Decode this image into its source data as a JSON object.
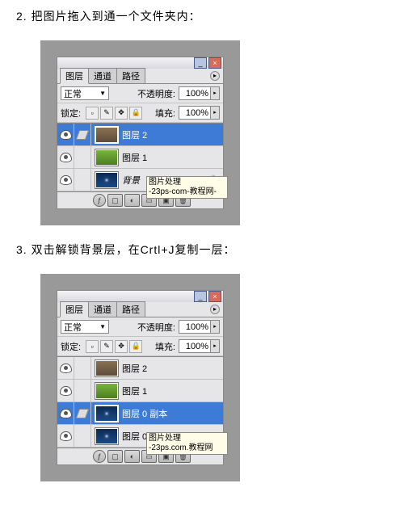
{
  "steps": {
    "s2": "2. 把图片拖入到通一个文件夹内：",
    "s3": "3. 双击解锁背景层，在Crtl+J复制一层："
  },
  "panel": {
    "tabs": {
      "layers": "图层",
      "channels": "通道",
      "paths": "路径"
    },
    "blendMode": "正常",
    "opacityLabel": "不透明度:",
    "opacityVal": "100%",
    "lockLabel": "锁定:",
    "fillLabel": "填充:",
    "fillVal": "100%"
  },
  "layers1": [
    {
      "name": "图层 2",
      "thumb": "t-brown",
      "sel": true,
      "italic": false,
      "lock": false
    },
    {
      "name": "图层 1",
      "thumb": "t-green",
      "sel": false,
      "italic": false,
      "lock": false
    },
    {
      "name": "背景",
      "thumb": "t-blue",
      "sel": false,
      "italic": true,
      "lock": true
    }
  ],
  "layers2": [
    {
      "name": "图层 2",
      "thumb": "t-brown",
      "sel": false
    },
    {
      "name": "图层 1",
      "thumb": "t-green",
      "sel": false
    },
    {
      "name": "图层 0 副本",
      "thumb": "t-blue",
      "sel": true
    },
    {
      "name": "图层 0",
      "thumb": "t-blue",
      "sel": false
    }
  ],
  "tooltip1": {
    "l1": "图片处理",
    "l2": "-23ps-com-教程网-"
  },
  "tooltip2": {
    "l1": "图片处理",
    "l2": "-23ps.com.教程网"
  }
}
